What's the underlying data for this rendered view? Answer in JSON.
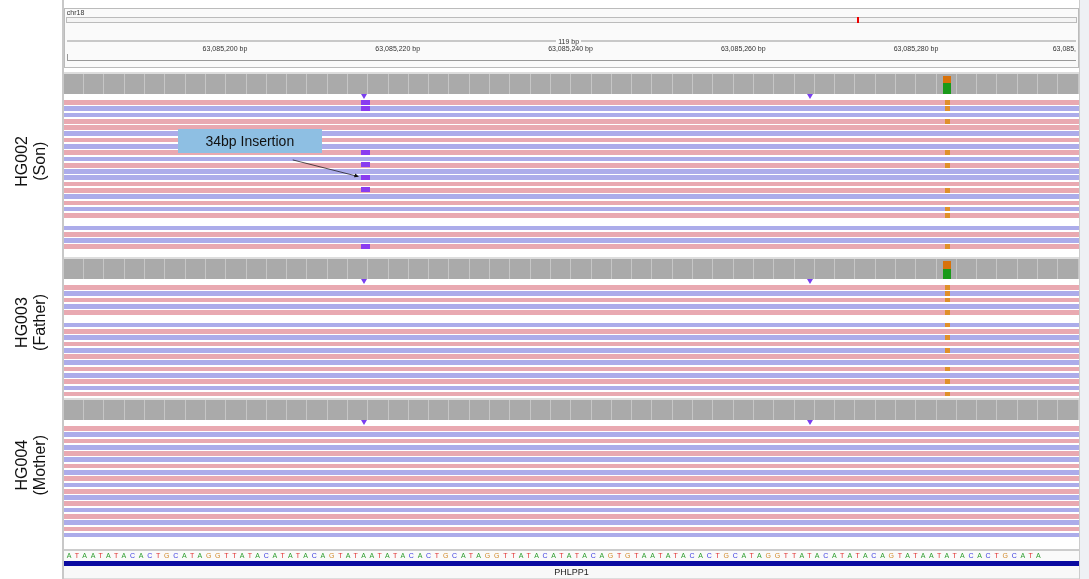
{
  "locus": {
    "chromosome": "chr18",
    "span": "119 bp",
    "ticks": [
      "63,085,200 bp",
      "63,085,220 bp",
      "63,085,240 bp",
      "63,085,260 bp",
      "63,085,280 bp",
      "63,085,"
    ]
  },
  "tracks": [
    {
      "label": "HG002",
      "sublabel": "(Son)",
      "variant": {
        "level": 0.4
      },
      "reads": [
        {
          "kind": "forward",
          "insertion": true,
          "mismatch": true
        },
        {
          "kind": "reverse",
          "insertion": true,
          "mismatch": true
        },
        {
          "kind": "reverse",
          "insertion": false,
          "mismatch": false
        },
        {
          "kind": "forward",
          "insertion": false,
          "mismatch": true
        },
        {
          "kind": "forward",
          "insertion": false,
          "mismatch": false
        },
        {
          "kind": "reverse",
          "insertion": false,
          "mismatch": false
        },
        {
          "kind": "forward",
          "insertion": false,
          "mismatch": false
        },
        {
          "kind": "reverse",
          "insertion": false,
          "mismatch": false
        },
        {
          "kind": "forward",
          "insertion": true,
          "mismatch": true
        },
        {
          "kind": "reverse",
          "insertion": false,
          "mismatch": false
        },
        {
          "kind": "forward",
          "insertion": true,
          "mismatch": true
        },
        {
          "kind": "reverse",
          "insertion": false,
          "mismatch": false
        },
        {
          "kind": "reverse",
          "insertion": true,
          "mismatch": false
        },
        {
          "kind": "forward",
          "insertion": false,
          "mismatch": false
        },
        {
          "kind": "forward",
          "insertion": true,
          "mismatch": true
        },
        {
          "kind": "reverse",
          "insertion": false,
          "mismatch": false
        },
        {
          "kind": "forward",
          "insertion": false,
          "mismatch": false
        },
        {
          "kind": "reverse",
          "insertion": false,
          "mismatch": true
        },
        {
          "kind": "forward",
          "insertion": false,
          "mismatch": true
        },
        {
          "kind": "empty",
          "insertion": false,
          "mismatch": false
        },
        {
          "kind": "reverse",
          "insertion": false,
          "mismatch": false
        },
        {
          "kind": "forward",
          "insertion": false,
          "mismatch": false
        },
        {
          "kind": "reverse",
          "insertion": false,
          "mismatch": false
        },
        {
          "kind": "forward",
          "insertion": true,
          "mismatch": true
        }
      ]
    },
    {
      "label": "HG003",
      "sublabel": "(Father)",
      "variant": {
        "level": 0.45
      },
      "reads": [
        {
          "kind": "forward",
          "mismatch": true
        },
        {
          "kind": "reverse",
          "mismatch": true
        },
        {
          "kind": "forward",
          "mismatch": true
        },
        {
          "kind": "reverse",
          "mismatch": false
        },
        {
          "kind": "forward",
          "mismatch": true
        },
        {
          "kind": "empty",
          "mismatch": false
        },
        {
          "kind": "reverse",
          "mismatch": true
        },
        {
          "kind": "forward",
          "mismatch": false
        },
        {
          "kind": "reverse",
          "mismatch": true
        },
        {
          "kind": "forward",
          "mismatch": false
        },
        {
          "kind": "reverse",
          "mismatch": true
        },
        {
          "kind": "forward",
          "mismatch": false
        },
        {
          "kind": "reverse",
          "mismatch": false
        },
        {
          "kind": "forward",
          "mismatch": true
        },
        {
          "kind": "reverse",
          "mismatch": false
        },
        {
          "kind": "forward",
          "mismatch": true
        },
        {
          "kind": "reverse",
          "mismatch": false
        },
        {
          "kind": "forward",
          "mismatch": true
        }
      ]
    },
    {
      "label": "HG004",
      "sublabel": "(Mother)",
      "reads": [
        {
          "kind": "forward"
        },
        {
          "kind": "reverse"
        },
        {
          "kind": "forward"
        },
        {
          "kind": "reverse"
        },
        {
          "kind": "forward"
        },
        {
          "kind": "reverse"
        },
        {
          "kind": "forward"
        },
        {
          "kind": "reverse"
        },
        {
          "kind": "forward"
        },
        {
          "kind": "reverse"
        },
        {
          "kind": "forward"
        },
        {
          "kind": "reverse"
        },
        {
          "kind": "forward"
        },
        {
          "kind": "reverse"
        },
        {
          "kind": "forward"
        },
        {
          "kind": "reverse"
        },
        {
          "kind": "forward"
        },
        {
          "kind": "reverse"
        }
      ]
    }
  ],
  "callout": {
    "text": "34bp Insertion"
  },
  "sequence": "ATAATATACACTGCATAGGTTATACATATACAGTATAATATACACTGCATAGGTTATACATATACAGTGTAATATACACTGCATAGGTTATACATATACAGTATAATATACACTGCATA",
  "gene": {
    "name": "PHLPP1"
  }
}
